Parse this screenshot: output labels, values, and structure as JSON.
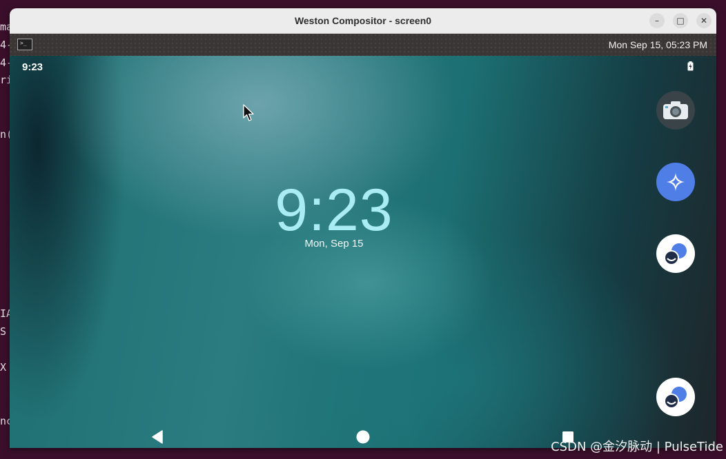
{
  "window": {
    "title": "Weston Compositor - screen0",
    "minimize_glyph": "–",
    "maximize_glyph": "□",
    "close_glyph": "✕"
  },
  "weston_panel": {
    "launcher_icon": "terminal-icon",
    "launcher_glyph": ">_",
    "clock": "Mon Sep 15, 05:23 PM"
  },
  "background_terminal": {
    "lines": [
      {
        "text": "ma"
      },
      {
        "text": "4-"
      },
      {
        "text": "4-"
      },
      {
        "text": "ri"
      },
      {
        "text": "n("
      },
      {
        "text": "IA"
      },
      {
        "text": "S"
      },
      {
        "text": "X"
      },
      {
        "text": "nc"
      }
    ]
  },
  "android": {
    "status_time": "9:23",
    "battery_icon": "battery-charging-icon",
    "lock_clock": "9:23",
    "lock_date": "Mon, Sep 15",
    "side_apps": [
      {
        "icon": "camera-icon"
      },
      {
        "icon": "gemini-sparkle-icon"
      },
      {
        "icon": "messages-icon"
      },
      {
        "icon": "messages-icon"
      }
    ],
    "nav": {
      "back_icon": "back-triangle-icon",
      "home_icon": "home-circle-icon",
      "recents_icon": "recents-square-icon"
    },
    "colors": {
      "clock": "#a9ecf4",
      "gemini_blue": "#4f7fe6",
      "camera_bg": "#3a4448"
    }
  },
  "watermark": "CSDN @金汐脉动 | PulseTide"
}
